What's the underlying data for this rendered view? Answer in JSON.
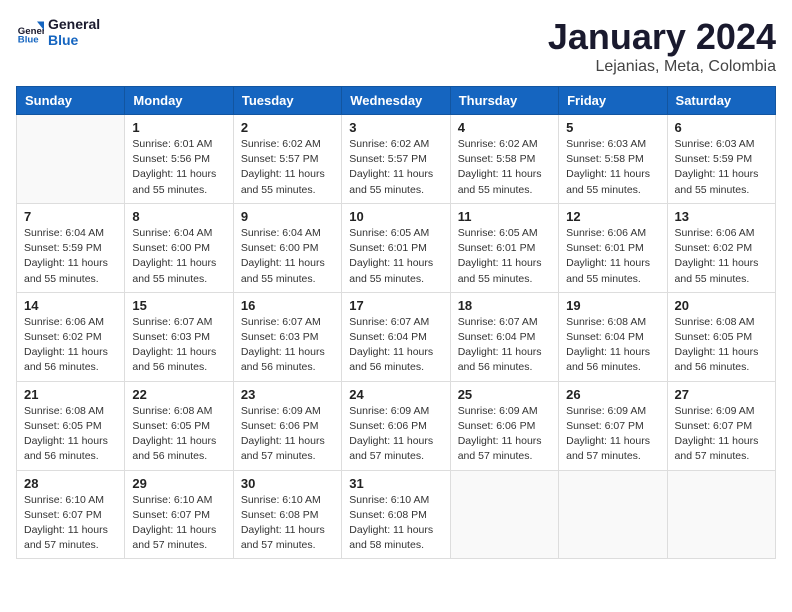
{
  "logo": {
    "line1": "General",
    "line2": "Blue"
  },
  "title": "January 2024",
  "subtitle": "Lejanias, Meta, Colombia",
  "weekdays": [
    "Sunday",
    "Monday",
    "Tuesday",
    "Wednesday",
    "Thursday",
    "Friday",
    "Saturday"
  ],
  "weeks": [
    [
      {
        "day": "",
        "info": ""
      },
      {
        "day": "1",
        "info": "Sunrise: 6:01 AM\nSunset: 5:56 PM\nDaylight: 11 hours\nand 55 minutes."
      },
      {
        "day": "2",
        "info": "Sunrise: 6:02 AM\nSunset: 5:57 PM\nDaylight: 11 hours\nand 55 minutes."
      },
      {
        "day": "3",
        "info": "Sunrise: 6:02 AM\nSunset: 5:57 PM\nDaylight: 11 hours\nand 55 minutes."
      },
      {
        "day": "4",
        "info": "Sunrise: 6:02 AM\nSunset: 5:58 PM\nDaylight: 11 hours\nand 55 minutes."
      },
      {
        "day": "5",
        "info": "Sunrise: 6:03 AM\nSunset: 5:58 PM\nDaylight: 11 hours\nand 55 minutes."
      },
      {
        "day": "6",
        "info": "Sunrise: 6:03 AM\nSunset: 5:59 PM\nDaylight: 11 hours\nand 55 minutes."
      }
    ],
    [
      {
        "day": "7",
        "info": "Sunrise: 6:04 AM\nSunset: 5:59 PM\nDaylight: 11 hours\nand 55 minutes."
      },
      {
        "day": "8",
        "info": "Sunrise: 6:04 AM\nSunset: 6:00 PM\nDaylight: 11 hours\nand 55 minutes."
      },
      {
        "day": "9",
        "info": "Sunrise: 6:04 AM\nSunset: 6:00 PM\nDaylight: 11 hours\nand 55 minutes."
      },
      {
        "day": "10",
        "info": "Sunrise: 6:05 AM\nSunset: 6:01 PM\nDaylight: 11 hours\nand 55 minutes."
      },
      {
        "day": "11",
        "info": "Sunrise: 6:05 AM\nSunset: 6:01 PM\nDaylight: 11 hours\nand 55 minutes."
      },
      {
        "day": "12",
        "info": "Sunrise: 6:06 AM\nSunset: 6:01 PM\nDaylight: 11 hours\nand 55 minutes."
      },
      {
        "day": "13",
        "info": "Sunrise: 6:06 AM\nSunset: 6:02 PM\nDaylight: 11 hours\nand 55 minutes."
      }
    ],
    [
      {
        "day": "14",
        "info": "Sunrise: 6:06 AM\nSunset: 6:02 PM\nDaylight: 11 hours\nand 56 minutes."
      },
      {
        "day": "15",
        "info": "Sunrise: 6:07 AM\nSunset: 6:03 PM\nDaylight: 11 hours\nand 56 minutes."
      },
      {
        "day": "16",
        "info": "Sunrise: 6:07 AM\nSunset: 6:03 PM\nDaylight: 11 hours\nand 56 minutes."
      },
      {
        "day": "17",
        "info": "Sunrise: 6:07 AM\nSunset: 6:04 PM\nDaylight: 11 hours\nand 56 minutes."
      },
      {
        "day": "18",
        "info": "Sunrise: 6:07 AM\nSunset: 6:04 PM\nDaylight: 11 hours\nand 56 minutes."
      },
      {
        "day": "19",
        "info": "Sunrise: 6:08 AM\nSunset: 6:04 PM\nDaylight: 11 hours\nand 56 minutes."
      },
      {
        "day": "20",
        "info": "Sunrise: 6:08 AM\nSunset: 6:05 PM\nDaylight: 11 hours\nand 56 minutes."
      }
    ],
    [
      {
        "day": "21",
        "info": "Sunrise: 6:08 AM\nSunset: 6:05 PM\nDaylight: 11 hours\nand 56 minutes."
      },
      {
        "day": "22",
        "info": "Sunrise: 6:08 AM\nSunset: 6:05 PM\nDaylight: 11 hours\nand 56 minutes."
      },
      {
        "day": "23",
        "info": "Sunrise: 6:09 AM\nSunset: 6:06 PM\nDaylight: 11 hours\nand 57 minutes."
      },
      {
        "day": "24",
        "info": "Sunrise: 6:09 AM\nSunset: 6:06 PM\nDaylight: 11 hours\nand 57 minutes."
      },
      {
        "day": "25",
        "info": "Sunrise: 6:09 AM\nSunset: 6:06 PM\nDaylight: 11 hours\nand 57 minutes."
      },
      {
        "day": "26",
        "info": "Sunrise: 6:09 AM\nSunset: 6:07 PM\nDaylight: 11 hours\nand 57 minutes."
      },
      {
        "day": "27",
        "info": "Sunrise: 6:09 AM\nSunset: 6:07 PM\nDaylight: 11 hours\nand 57 minutes."
      }
    ],
    [
      {
        "day": "28",
        "info": "Sunrise: 6:10 AM\nSunset: 6:07 PM\nDaylight: 11 hours\nand 57 minutes."
      },
      {
        "day": "29",
        "info": "Sunrise: 6:10 AM\nSunset: 6:07 PM\nDaylight: 11 hours\nand 57 minutes."
      },
      {
        "day": "30",
        "info": "Sunrise: 6:10 AM\nSunset: 6:08 PM\nDaylight: 11 hours\nand 57 minutes."
      },
      {
        "day": "31",
        "info": "Sunrise: 6:10 AM\nSunset: 6:08 PM\nDaylight: 11 hours\nand 58 minutes."
      },
      {
        "day": "",
        "info": ""
      },
      {
        "day": "",
        "info": ""
      },
      {
        "day": "",
        "info": ""
      }
    ]
  ]
}
